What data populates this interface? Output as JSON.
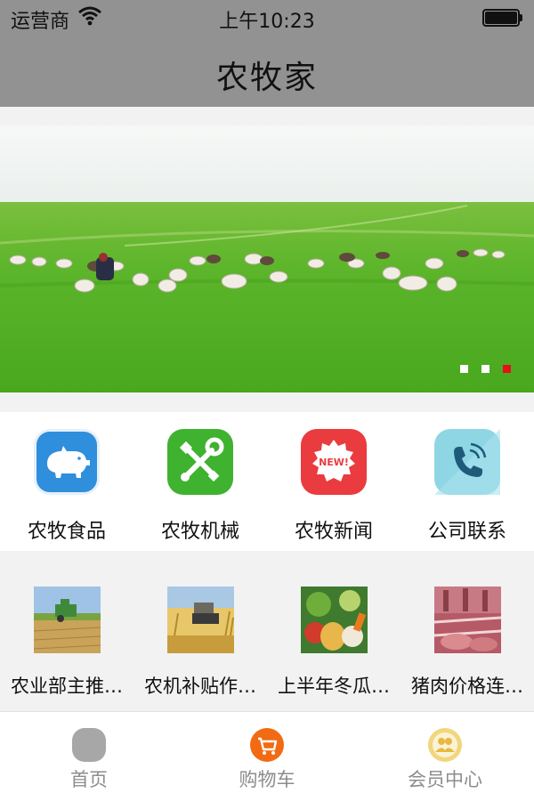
{
  "status_bar": {
    "carrier": "运营商",
    "time": "上午10:23"
  },
  "nav": {
    "title": "农牧家"
  },
  "banner": {
    "slides": 3,
    "active_slide": 3
  },
  "categories": [
    {
      "label": "农牧食品",
      "icon": "pig-icon",
      "color": "#2f8fdc"
    },
    {
      "label": "农牧机械",
      "icon": "wrench-icon",
      "color": "#3fb22f"
    },
    {
      "label": "农牧新闻",
      "icon": "new-badge-icon",
      "color": "#ea3b3f"
    },
    {
      "label": "公司联系",
      "icon": "phone-icon",
      "color": "#8fd6e4"
    }
  ],
  "news": [
    {
      "caption": "农业部主推…",
      "thumb": "harvester-field-thumbnail"
    },
    {
      "caption": "农机补贴作…",
      "thumb": "rice-harvest-thumbnail"
    },
    {
      "caption": "上半年冬瓜…",
      "thumb": "vegetables-thumbnail"
    },
    {
      "caption": "猪肉价格连…",
      "thumb": "pork-meat-thumbnail"
    }
  ],
  "tabs": [
    {
      "label": "首页",
      "icon": "home-icon",
      "color": "#a7a7a7"
    },
    {
      "label": "购物车",
      "icon": "shopping-cart-icon",
      "color": "#f26a11"
    },
    {
      "label": "会员中心",
      "icon": "member-icon",
      "color": "#f1d67c"
    }
  ]
}
